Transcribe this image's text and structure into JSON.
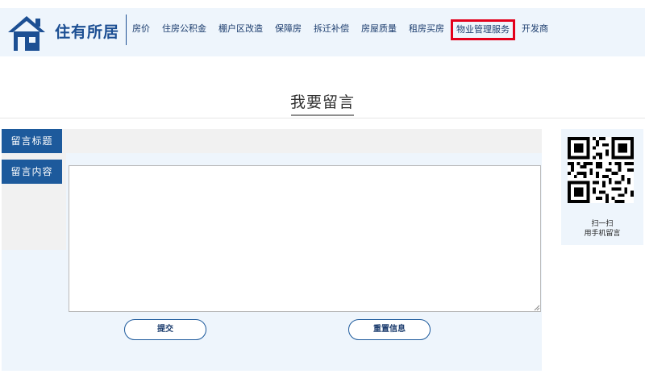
{
  "header": {
    "brand": "住有所居",
    "nav": [
      {
        "label": "房价"
      },
      {
        "label": "住房公积金"
      },
      {
        "label": "棚户区改造"
      },
      {
        "label": "保障房"
      },
      {
        "label": "拆迁补偿"
      },
      {
        "label": "房屋质量"
      },
      {
        "label": "租房买房"
      },
      {
        "label": "物业管理服务",
        "active": true
      },
      {
        "label": "开发商"
      }
    ]
  },
  "page": {
    "title": "我要留言"
  },
  "form": {
    "title_label": "留言标题",
    "content_label": "留言内容",
    "title_value": "",
    "content_value": "",
    "submit_label": "提交",
    "reset_label": "重置信息"
  },
  "qr": {
    "line1": "扫一扫",
    "line2": "用手机留言"
  },
  "colors": {
    "brand_blue": "#1d5a9c",
    "panel_bg": "#eef5fc",
    "active_outline": "#e3001b"
  },
  "icons": {
    "logo": "house-icon",
    "qr": "qr-code-icon"
  }
}
